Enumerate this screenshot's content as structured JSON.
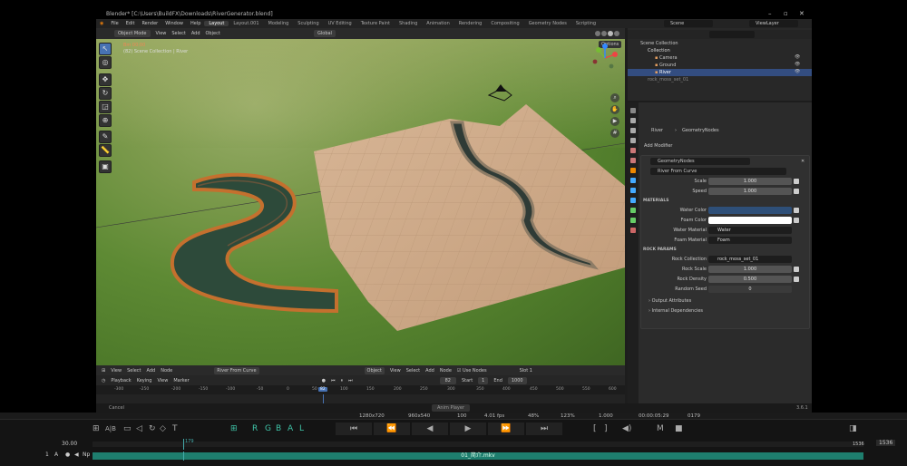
{
  "titlebar": {
    "title": "Blender* [C:\\Users\\BuildFX\\Downloads\\RiverGenerator.blend]"
  },
  "menu": {
    "items": [
      "File",
      "Edit",
      "Render",
      "Window",
      "Help"
    ]
  },
  "workspaces": [
    "Layout",
    "Layout.001",
    "Modeling",
    "Sculpting",
    "UV Editing",
    "Texture Paint",
    "Shading",
    "Animation",
    "Rendering",
    "Compositing",
    "Geometry Nodes",
    "Scripting"
  ],
  "scene_name": "Scene",
  "view_layer": "ViewLayer",
  "viewport": {
    "header": {
      "mode": "Object Mode",
      "menus": [
        "View",
        "Select",
        "Add",
        "Object"
      ],
      "orientation": "Global"
    },
    "options_label": "Options",
    "info_line1": "Bm 00:00",
    "info_line2": "(82) Scene Collection | River"
  },
  "outliner": {
    "root": "Scene Collection",
    "items": [
      {
        "name": "Collection",
        "level": 1
      },
      {
        "name": "Camera",
        "level": 2
      },
      {
        "name": "Ground",
        "level": 2
      },
      {
        "name": "River",
        "level": 2,
        "selected": true
      },
      {
        "name": "rock_moss_set_01",
        "level": 1
      }
    ]
  },
  "properties": {
    "breadcrumb_object": "River",
    "breadcrumb_modifier": "GeometryNodes",
    "add_modifier": "Add Modifier",
    "modifier_name": "GeometryNodes",
    "node_group": "River From Curve",
    "params": [
      {
        "label": "Scale",
        "value": "1.000"
      },
      {
        "label": "Speed",
        "value": "1.000"
      }
    ],
    "materials_section": "MATERIALS",
    "water_color_label": "Water Color",
    "water_color": "#2e4f78",
    "foam_color_label": "Foam Color",
    "foam_color": "#ffffff",
    "water_material_label": "Water Material",
    "water_material": "Water",
    "foam_material_label": "Foam Material",
    "foam_material": "Foam",
    "rock_section": "ROCK PARAMS",
    "rock_collection_label": "Rock Collection",
    "rock_collection": "rock_moss_set_01",
    "rock_scale_label": "Rock Scale",
    "rock_scale": "1.000",
    "rock_density_label": "Rock Density",
    "rock_density": "0.500",
    "random_seed_label": "Random Seed",
    "random_seed": "0",
    "output_attributes": "Output Attributes",
    "internal_dependencies": "Internal Dependencies"
  },
  "node_header": {
    "menus": [
      "View",
      "Select",
      "Add",
      "Node"
    ],
    "node_tree": "River From Curve",
    "obj_label": "Object",
    "menus2": [
      "View",
      "Select",
      "Add",
      "Node"
    ],
    "use_nodes": "Use Nodes",
    "slot": "Slot 1"
  },
  "timeline": {
    "menus": [
      "Playback",
      "Keying",
      "View",
      "Marker"
    ],
    "current_frame": "82",
    "start_label": "Start",
    "start": "1",
    "end_label": "End",
    "end": "1000",
    "ruler": [
      "-300",
      "-250",
      "-200",
      "-150",
      "-100",
      "-50",
      "0",
      "50",
      "82",
      "100",
      "150",
      "200",
      "250",
      "300",
      "350",
      "400",
      "450",
      "500",
      "550",
      "600"
    ]
  },
  "status": {
    "left": "Cancel",
    "center": "Anim Player",
    "version": "3.6.1"
  },
  "player": {
    "resolution1": "1280x720",
    "resolution2": "960x540",
    "speed": "100",
    "fps": "4.01 fps",
    "percent": "48%",
    "zoom": "123%",
    "ratio": "1.000",
    "timecode": "00:00:05:29",
    "frame": "0179",
    "channels": [
      "R",
      "G",
      "B",
      "A",
      "L"
    ],
    "framerate": "30.00",
    "marker": "179",
    "end_frame": "1536",
    "end_frame2": "1536",
    "clip_name": "01_简介.mkv",
    "track_id": "1",
    "track_a": "A",
    "track_np": "Np"
  },
  "colors": {
    "accent": "#4772b3",
    "selection": "#334d80",
    "clip": "#1e7e6e",
    "teal": "#3fc4a8"
  }
}
